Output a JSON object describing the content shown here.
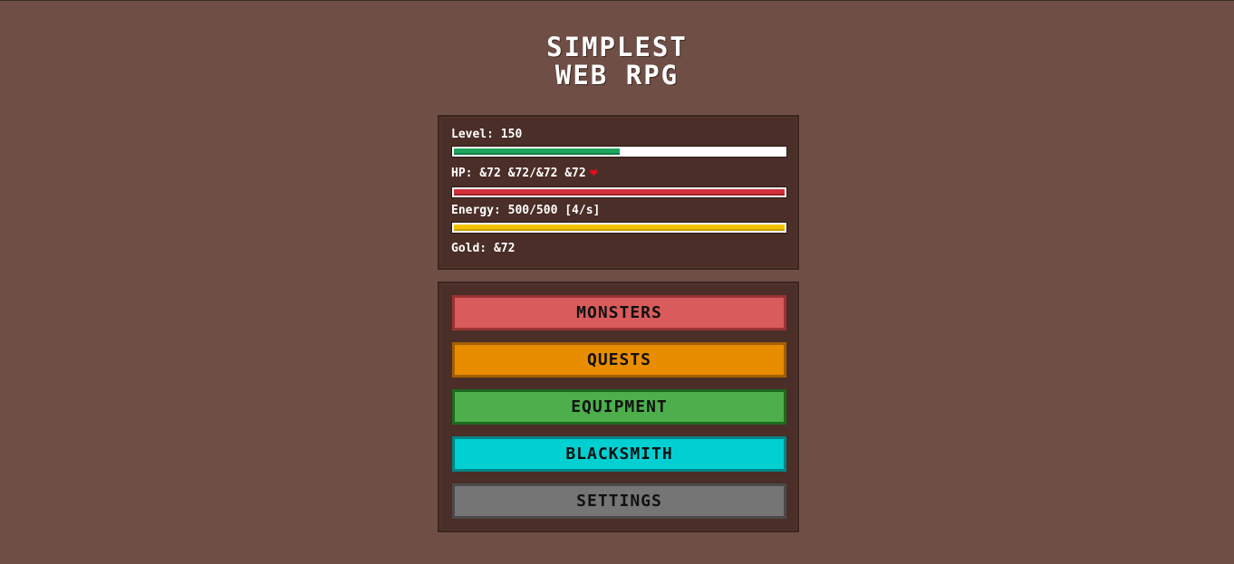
{
  "title": {
    "line1": "SIMPLEST",
    "line2": "WEB RPG"
  },
  "stats": {
    "level_label": "Level: 150",
    "level_progress": 0.5,
    "hp_label": "HP: &72 &72/&72 &72",
    "hp_progress": 1.0,
    "energy_label": "Energy: 500/500 [4/s]",
    "energy_progress": 1.0,
    "gold_label": "Gold: &72",
    "heart_icon": "heart-icon"
  },
  "menu": {
    "buttons": [
      {
        "label": "MONSTERS",
        "color": "#d95b5b",
        "border": "#9c3434"
      },
      {
        "label": "QUESTS",
        "color": "#e88c00",
        "border": "#a55f00"
      },
      {
        "label": "EQUIPMENT",
        "color": "#4caf4c",
        "border": "#1d6b1d"
      },
      {
        "label": "BLACKSMITH",
        "color": "#00d0d2",
        "border": "#008587"
      },
      {
        "label": "SETTINGS",
        "color": "#757575",
        "border": "#4a4a4a"
      }
    ]
  },
  "colors": {
    "background": "#6f4e45",
    "panel": "#4a2e27",
    "level_bar": "#1fa55e",
    "hp_bar": "#d32f3a",
    "energy_bar": "#f2c200",
    "heart": "#e30f1b"
  }
}
